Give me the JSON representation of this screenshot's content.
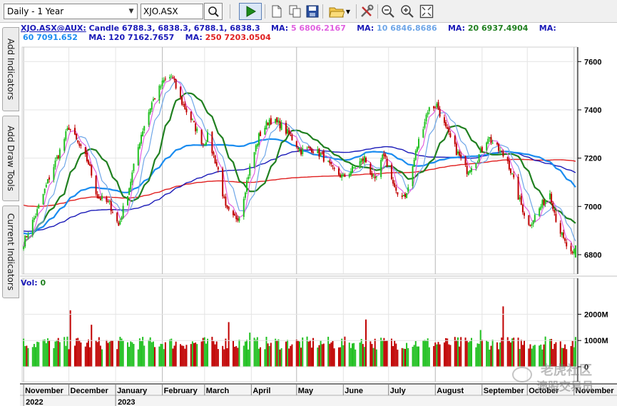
{
  "toolbar": {
    "period_value": "Daily - 1 Year",
    "symbol_value": "XJO.ASX",
    "icons": [
      "search-icon",
      "play-icon",
      "new-document-icon",
      "copy-icon",
      "save-icon",
      "open-folder-icon",
      "chevron-down-icon",
      "tools-icon",
      "zoom-out-icon",
      "zoom-in-icon",
      "fit-window-icon"
    ]
  },
  "side_tabs": [
    "Add Indicators",
    "Add Draw Tools",
    "Current Indicators"
  ],
  "price_info": {
    "instrument": "XJO.ASX@AUX:",
    "candle_label": "Candle",
    "candle_values": "6788.3, 6838.3, 6788.1, 6838.3",
    "ma5_label": "MA:",
    "ma5_value": "5 6806.2167",
    "ma10_label": "MA:",
    "ma10_value": "10 6846.8686",
    "ma20_label": "MA:",
    "ma20_value": "20 6937.4904",
    "ma60_label": "MA:",
    "ma60_value": "60 7091.652",
    "ma120_label": "MA:",
    "ma120_value": "120 7162.7657",
    "ma250_label": "MA:",
    "ma250_value": "250 7203.0504"
  },
  "volume_info": {
    "label": "Vol:",
    "value": "0"
  },
  "colors": {
    "ma5": "#e060e0",
    "ma10": "#6ea6e8",
    "ma20": "#208020",
    "ma60": "#1a8cf0",
    "ma120": "#1a1ab8",
    "ma250": "#e02020",
    "up": "#20c020",
    "down": "#c00000"
  },
  "watermark": {
    "line1": "老虎社区",
    "line2": "澳股交易员"
  },
  "chart_data": [
    {
      "type": "candlestick",
      "title": "XJO.ASX@AUX",
      "y_ticks": [
        "7600",
        "7400",
        "7200",
        "7000",
        "6800"
      ],
      "ylim": [
        6720,
        7660
      ],
      "x_months": [
        "November",
        "December",
        "January",
        "February",
        "March",
        "April",
        "May",
        "June",
        "July",
        "August",
        "September",
        "October",
        "November"
      ],
      "x_years": [
        "2022",
        "2023"
      ],
      "last_candle": {
        "open": 6788.3,
        "high": 6838.3,
        "low": 6788.1,
        "close": 6838.3
      },
      "price_anchors": [
        [
          "2022-11-01",
          6850
        ],
        [
          "2022-11-10",
          6980
        ],
        [
          "2022-11-18",
          7120
        ],
        [
          "2022-11-25",
          7230
        ],
        [
          "2022-12-01",
          7330
        ],
        [
          "2022-12-07",
          7260
        ],
        [
          "2022-12-14",
          7180
        ],
        [
          "2022-12-20",
          7040
        ],
        [
          "2022-12-28",
          7010
        ],
        [
          "2023-01-03",
          6920
        ],
        [
          "2023-01-10",
          7080
        ],
        [
          "2023-01-18",
          7300
        ],
        [
          "2023-01-25",
          7430
        ],
        [
          "2023-02-02",
          7520
        ],
        [
          "2023-02-07",
          7540
        ],
        [
          "2023-02-14",
          7430
        ],
        [
          "2023-02-21",
          7350
        ],
        [
          "2023-02-28",
          7260
        ],
        [
          "2023-03-03",
          7290
        ],
        [
          "2023-03-10",
          7150
        ],
        [
          "2023-03-15",
          6990
        ],
        [
          "2023-03-20",
          6950
        ],
        [
          "2023-03-24",
          6960
        ],
        [
          "2023-03-31",
          7160
        ],
        [
          "2023-04-06",
          7290
        ],
        [
          "2023-04-13",
          7360
        ],
        [
          "2023-04-20",
          7340
        ],
        [
          "2023-04-27",
          7290
        ],
        [
          "2023-05-04",
          7230
        ],
        [
          "2023-05-11",
          7240
        ],
        [
          "2023-05-18",
          7210
        ],
        [
          "2023-05-25",
          7150
        ],
        [
          "2023-06-01",
          7120
        ],
        [
          "2023-06-08",
          7160
        ],
        [
          "2023-06-15",
          7200
        ],
        [
          "2023-06-22",
          7100
        ],
        [
          "2023-06-28",
          7220
        ],
        [
          "2023-07-06",
          7050
        ],
        [
          "2023-07-13",
          7050
        ],
        [
          "2023-07-20",
          7250
        ],
        [
          "2023-07-27",
          7400
        ],
        [
          "2023-08-02",
          7420
        ],
        [
          "2023-08-08",
          7320
        ],
        [
          "2023-08-15",
          7230
        ],
        [
          "2023-08-22",
          7150
        ],
        [
          "2023-08-29",
          7200
        ],
        [
          "2023-09-05",
          7290
        ],
        [
          "2023-09-11",
          7240
        ],
        [
          "2023-09-18",
          7190
        ],
        [
          "2023-09-25",
          7040
        ],
        [
          "2023-10-02",
          6920
        ],
        [
          "2023-10-09",
          6990
        ],
        [
          "2023-10-16",
          7060
        ],
        [
          "2023-10-20",
          6950
        ],
        [
          "2023-10-25",
          6860
        ],
        [
          "2023-10-31",
          6790
        ],
        [
          "2023-11-02",
          6838
        ]
      ]
    },
    {
      "type": "bar",
      "title": "Volume",
      "y_ticks": [
        "2000M",
        "1000M",
        "0"
      ],
      "ylim": [
        0,
        2500
      ],
      "value_label": "Vol: 0"
    }
  ]
}
